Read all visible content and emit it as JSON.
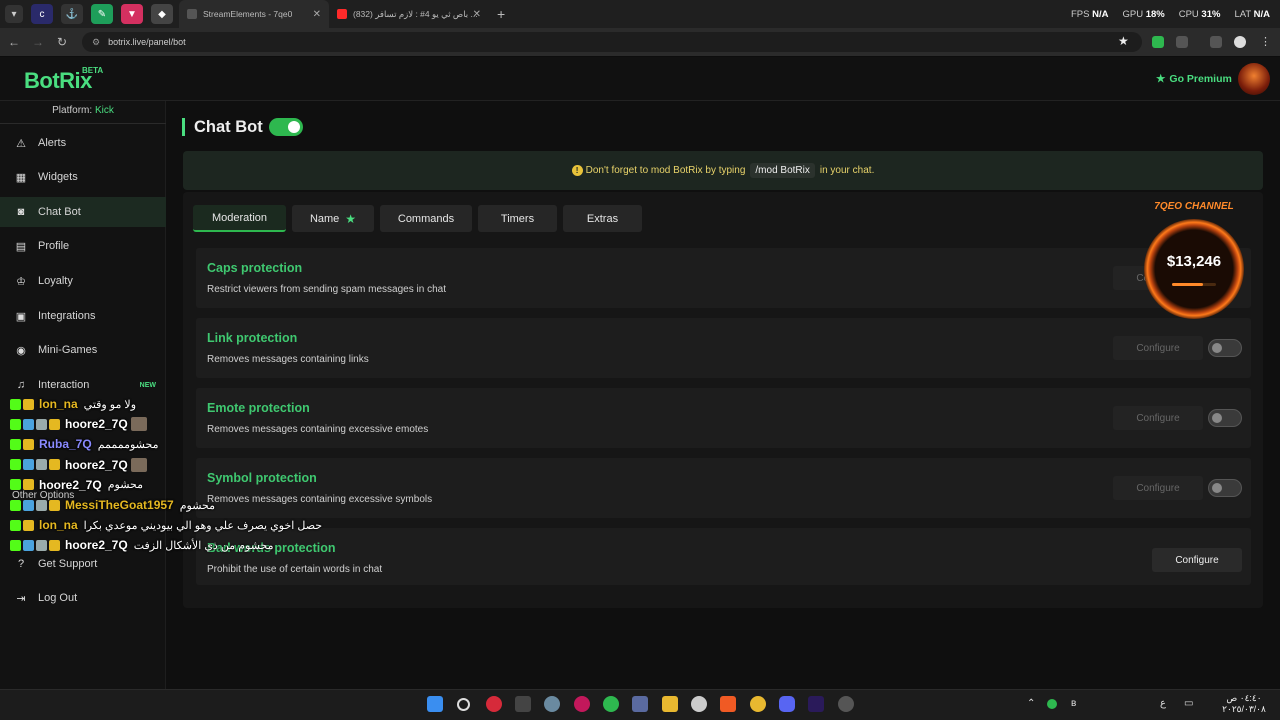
{
  "browser": {
    "tabs": [
      {
        "title": "StreamElements - 7qe0",
        "color": "#8aa0ff"
      },
      {
        "title": "(832) باص ثي يو 4# : لازم تسافر ...",
        "color": "#ff2a2a"
      }
    ],
    "perf": {
      "fps_label": "FPS",
      "fps_value": "N/A",
      "gpu_label": "GPU",
      "gpu_value": "18%",
      "cpu_label": "CPU",
      "cpu_value": "31%",
      "lat_label": "LAT",
      "lat_value": "N/A"
    },
    "url": "botrix.live/panel/bot"
  },
  "app": {
    "logo": "BotRix",
    "beta": "BETA",
    "go_premium": "Go Premium",
    "platform_label": "Platform:",
    "platform_value": "Kick"
  },
  "sidebar": {
    "items": [
      {
        "label": "Alerts",
        "icon": "warning-icon"
      },
      {
        "label": "Widgets",
        "icon": "grid-icon"
      },
      {
        "label": "Chat Bot",
        "icon": "robot-icon"
      },
      {
        "label": "Profile",
        "icon": "id-card-icon"
      },
      {
        "label": "Loyalty",
        "icon": "trophy-icon"
      },
      {
        "label": "Integrations",
        "icon": "plug-icon"
      },
      {
        "label": "Mini-Games",
        "icon": "gamepad-icon"
      },
      {
        "label": "Interaction",
        "icon": "music-icon",
        "badge": "NEW"
      },
      {
        "label": "Get Support",
        "icon": "help-icon"
      },
      {
        "label": "Log Out",
        "icon": "logout-icon"
      }
    ],
    "other_options": "Other Options"
  },
  "main": {
    "title": "Chat Bot",
    "notice_before": "Don't forget to mod BotRix by typing",
    "notice_code": "/mod BotRix",
    "notice_after": "in your chat.",
    "tabs": [
      {
        "label": "Moderation"
      },
      {
        "label": "Name"
      },
      {
        "label": "Commands"
      },
      {
        "label": "Timers"
      },
      {
        "label": "Extras"
      }
    ],
    "cards": [
      {
        "title": "Caps protection",
        "desc": "Restrict viewers from sending spam messages in chat",
        "button": "Configure"
      },
      {
        "title": "Link protection",
        "desc": "Removes messages containing links",
        "button": "Configure"
      },
      {
        "title": "Emote protection",
        "desc": "Removes messages containing excessive emotes",
        "button": "Configure"
      },
      {
        "title": "Symbol protection",
        "desc": "Removes messages containing excessive symbols",
        "button": "Configure"
      },
      {
        "title": "Bad words protection",
        "desc": "Prohibit the use of certain words in chat",
        "button": "Configure"
      }
    ]
  },
  "overlay_widget": {
    "channel": "7QEO CHANNEL",
    "amount": "$13,246",
    "progress": 0.7
  },
  "chat_overlay": [
    {
      "user": "lon_na",
      "color": "#e5b821",
      "msg": "ولا مو وقتي"
    },
    {
      "user": "hoore2_7Q",
      "color": "#ffffff",
      "msg": ""
    },
    {
      "user": "Ruba_7Q",
      "color": "#8a8aff",
      "msg": "محشوممممم"
    },
    {
      "user": "hoore2_7Q",
      "color": "#ffffff",
      "msg": ""
    },
    {
      "user": "hoore2_7Q",
      "color": "#ffffff",
      "msg": "محشوم"
    },
    {
      "user": "MessiTheGoat1957",
      "color": "#e5b821",
      "msg": "محشوم"
    },
    {
      "user": "lon_na",
      "color": "#e5b821",
      "msg": "حصل اخوي يصرف علي وهو الي بيوديني موعدي بكرا"
    },
    {
      "user": "hoore2_7Q",
      "color": "#ffffff",
      "msg": "محشوم من ذي الأشكال الزفت"
    }
  ],
  "taskbar": {
    "clock_time": "٠٤:٤٠ ص",
    "clock_date": "٢٠٢٥/٠٣/٠٨"
  }
}
